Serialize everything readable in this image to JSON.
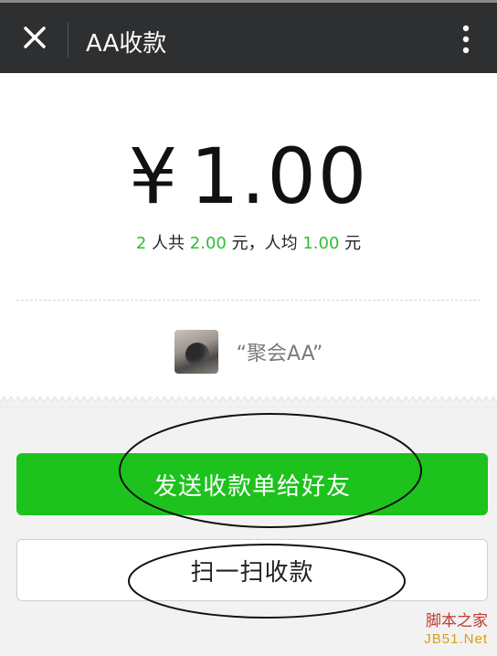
{
  "titlebar": {
    "title": "AA收款",
    "close_icon": "close-icon",
    "more_icon": "more-vertical-icon"
  },
  "payment": {
    "currency_symbol": "¥",
    "amount": "1.00",
    "summary": {
      "people_count": "2",
      "people_label": " 人共 ",
      "total": "2.00",
      "total_unit": " 元，人均 ",
      "per_person": "1.00",
      "per_person_unit": " 元"
    }
  },
  "group": {
    "name": "“聚会AA”",
    "avatar_icon": "group-avatar"
  },
  "actions": {
    "send_label": "发送收款单给好友",
    "scan_label": "扫一扫收款"
  },
  "watermark": {
    "line1": "脚本之家",
    "line2": "JB51.Net"
  },
  "colors": {
    "titlebar_bg": "#2d2f31",
    "accent_green": "#1dc21d",
    "summary_green": "#2fbf2f",
    "annotation_ink": "#111111"
  }
}
